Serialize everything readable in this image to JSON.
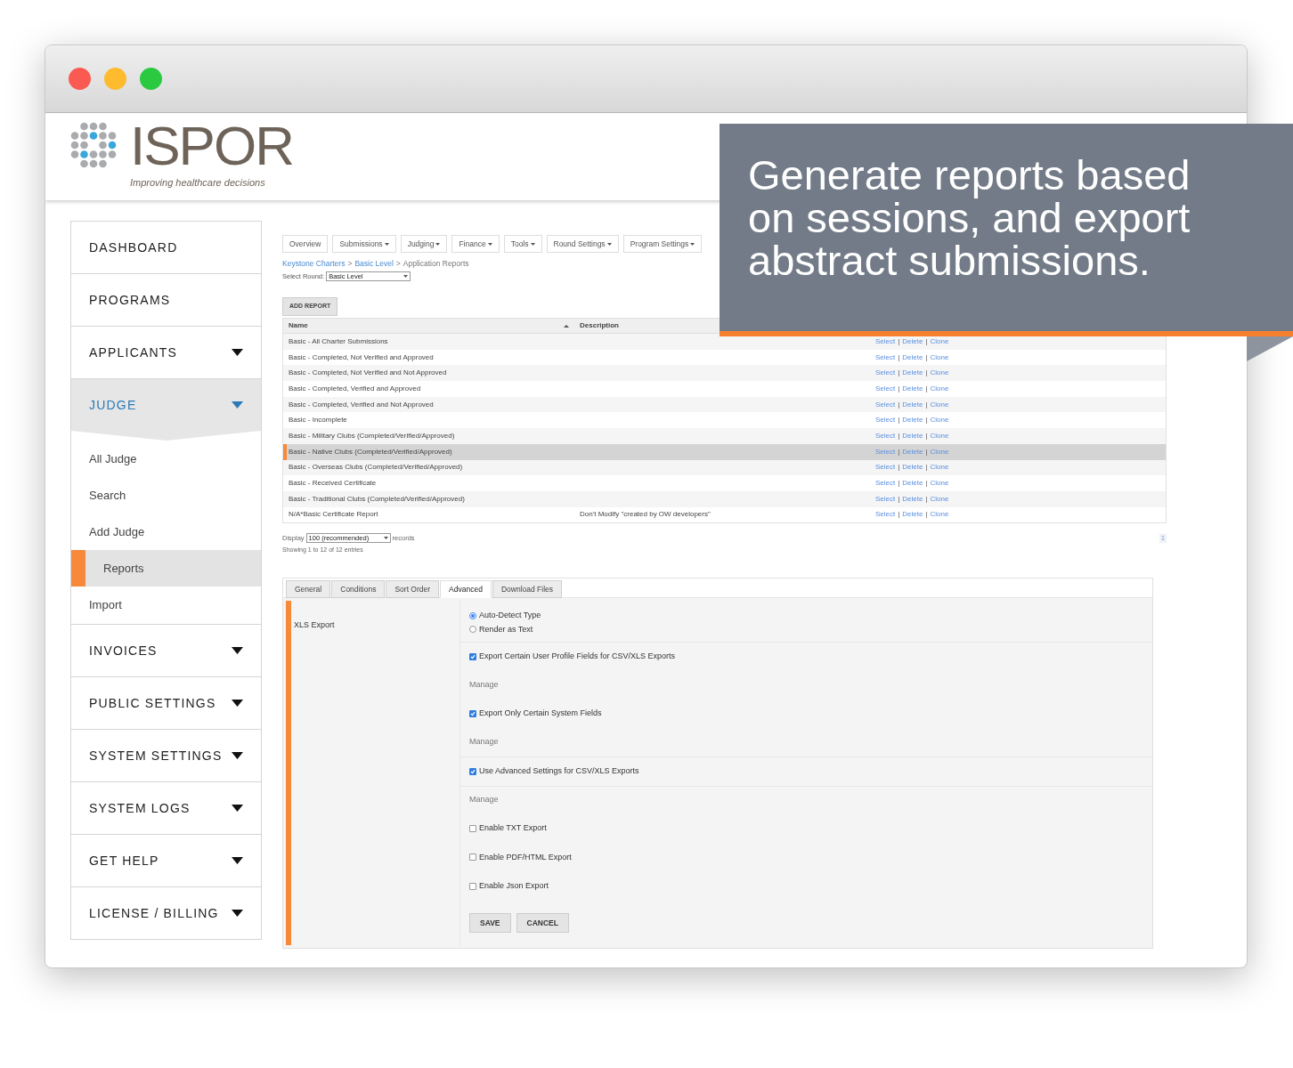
{
  "logo": {
    "name": "ISPOR",
    "tagline": "Improving healthcare decisions"
  },
  "callout": {
    "text": "Generate reports based on sessions, and export abstract submissions."
  },
  "sidebar": {
    "items": [
      {
        "label": "DASHBOARD",
        "expandable": false,
        "expanded": false
      },
      {
        "label": "PROGRAMS",
        "expandable": false,
        "expanded": false
      },
      {
        "label": "APPLICANTS",
        "expandable": true,
        "expanded": false
      },
      {
        "label": "JUDGE",
        "expandable": true,
        "expanded": true,
        "children": [
          {
            "label": "All Judge",
            "selected": false
          },
          {
            "label": "Search",
            "selected": false
          },
          {
            "label": "Add Judge",
            "selected": false
          },
          {
            "label": "Reports",
            "selected": true
          },
          {
            "label": "Import",
            "selected": false
          }
        ]
      },
      {
        "label": "INVOICES",
        "expandable": true,
        "expanded": false
      },
      {
        "label": "PUBLIC SETTINGS",
        "expandable": true,
        "expanded": false
      },
      {
        "label": "SYSTEM SETTINGS",
        "expandable": true,
        "expanded": false
      },
      {
        "label": "SYSTEM LOGS",
        "expandable": true,
        "expanded": false
      },
      {
        "label": "GET HELP",
        "expandable": true,
        "expanded": false
      },
      {
        "label": "LICENSE / BILLING",
        "expandable": true,
        "expanded": false
      }
    ]
  },
  "nav_tabs": [
    {
      "label": "Overview",
      "dropdown": false
    },
    {
      "label": "Submissions",
      "dropdown": true
    },
    {
      "label": "Judging",
      "dropdown": true
    },
    {
      "label": "Finance",
      "dropdown": true
    },
    {
      "label": "Tools",
      "dropdown": true
    },
    {
      "label": "Round Settings",
      "dropdown": true
    },
    {
      "label": "Program Settings",
      "dropdown": true
    }
  ],
  "breadcrumb": {
    "separator": ">",
    "items": [
      "Keystone Charters",
      "Basic Level",
      "Application Reports"
    ]
  },
  "select_round": {
    "label": "Select Round:",
    "value": "Basic Level"
  },
  "add_report_button": "ADD REPORT",
  "table": {
    "columns": [
      {
        "label": "Name",
        "sorted": true
      },
      {
        "label": "Description",
        "sorted": false
      }
    ],
    "action_separator": "|",
    "rows": [
      {
        "name": "Basic - All Charter Submissions",
        "selected": false,
        "actions": [
          "Select",
          "Delete",
          "Clone"
        ]
      },
      {
        "name": "Basic - Completed, Not Verified and Approved",
        "selected": false,
        "actions": [
          "Select",
          "Delete",
          "Clone"
        ]
      },
      {
        "name": "Basic - Completed, Not Verified and Not Approved",
        "selected": false,
        "actions": [
          "Select",
          "Delete",
          "Clone"
        ]
      },
      {
        "name": "Basic - Completed, Verified and Approved",
        "selected": false,
        "actions": [
          "Select",
          "Delete",
          "Clone"
        ]
      },
      {
        "name": "Basic - Completed, Verified and Not Approved",
        "selected": false,
        "actions": [
          "Select",
          "Delete",
          "Clone"
        ]
      },
      {
        "name": "Basic - Incomplete",
        "selected": false,
        "actions": [
          "Select",
          "Delete",
          "Clone"
        ]
      },
      {
        "name": "Basic - Military Clubs (Completed/Verified/Approved)",
        "selected": false,
        "actions": [
          "Select",
          "Delete",
          "Clone"
        ]
      },
      {
        "name": "Basic - Native Clubs (Completed/Verified/Approved)",
        "selected": true,
        "actions": [
          "Select",
          "Delete",
          "Clone"
        ]
      },
      {
        "name": "Basic - Overseas Clubs (Completed/Verified/Approved)",
        "selected": false,
        "actions": [
          "Select",
          "Delete",
          "Clone"
        ]
      },
      {
        "name": "Basic - Received Certificate",
        "selected": false,
        "actions": [
          "Select",
          "Delete",
          "Clone"
        ]
      },
      {
        "name": "Basic - Traditional Clubs (Completed/Verified/Approved)",
        "selected": false,
        "actions": [
          "Select",
          "Delete",
          "Clone"
        ]
      },
      {
        "name": "N/A*Basic Certificate Report",
        "description": "Don't Modify \"created by OW developers\"",
        "selected": false,
        "actions": [
          "Select",
          "Delete",
          "Clone"
        ]
      }
    ]
  },
  "display": {
    "label": "Display",
    "value": "100 (recommended)",
    "suffix": "records"
  },
  "info": "Showing 1 to 12 of 12 entries",
  "pagination": [
    {
      "label": "1",
      "selected": true
    }
  ],
  "form": {
    "tabs": [
      {
        "label": "General",
        "selected": false
      },
      {
        "label": "Conditions",
        "selected": false
      },
      {
        "label": "Sort Order",
        "selected": false
      },
      {
        "label": "Advanced",
        "selected": true
      },
      {
        "label": "Download Files",
        "selected": false
      }
    ],
    "section_label": "XLS Export",
    "rows": [
      {
        "kind": "radio",
        "options": [
          {
            "label": "Auto-Detect Type",
            "selected": true
          },
          {
            "label": "Render as Text",
            "selected": false
          }
        ]
      },
      {
        "kind": "checkbox",
        "label": "Export Certain User Profile Fields for CSV/XLS Exports",
        "checked": true
      },
      {
        "kind": "link",
        "label": "Manage"
      },
      {
        "kind": "checkbox",
        "label": "Export Only Certain System Fields",
        "checked": true
      },
      {
        "kind": "link",
        "label": "Manage"
      },
      {
        "kind": "checkbox",
        "label": "Use Advanced Settings for CSV/XLS Exports",
        "checked": true
      },
      {
        "kind": "link",
        "label": "Manage"
      },
      {
        "kind": "checkbox",
        "label": "Enable TXT Export",
        "checked": false
      },
      {
        "kind": "checkbox",
        "label": "Enable PDF/HTML Export",
        "checked": false
      },
      {
        "kind": "checkbox",
        "label": "Enable Json Export",
        "checked": false
      }
    ],
    "buttons": [
      "SAVE",
      "CANCEL"
    ]
  }
}
